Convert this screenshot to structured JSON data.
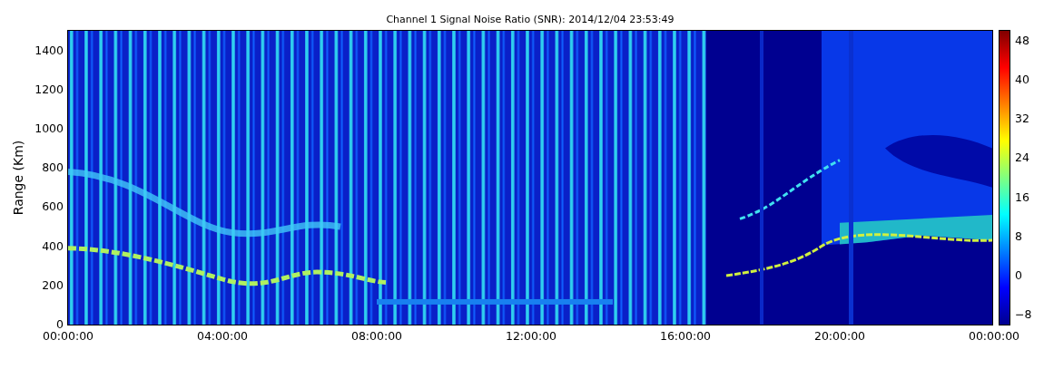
{
  "title": "Channel 1 Signal Noise Ratio (SNR): 2014/12/04 23:53:49",
  "plot": {
    "ylabel": "Range (Km)",
    "yticks": [
      "1400",
      "1200",
      "1000",
      "800",
      "600",
      "400",
      "200",
      "0"
    ],
    "xticks": [
      "00:00:00",
      "04:00:00",
      "08:00:00",
      "12:00:00",
      "16:00:00",
      "20:00:00",
      "00:00:00"
    ]
  },
  "colorbar": {
    "ticks": [
      "48",
      "40",
      "32",
      "24",
      "16",
      "8",
      "0",
      "−8"
    ]
  }
}
